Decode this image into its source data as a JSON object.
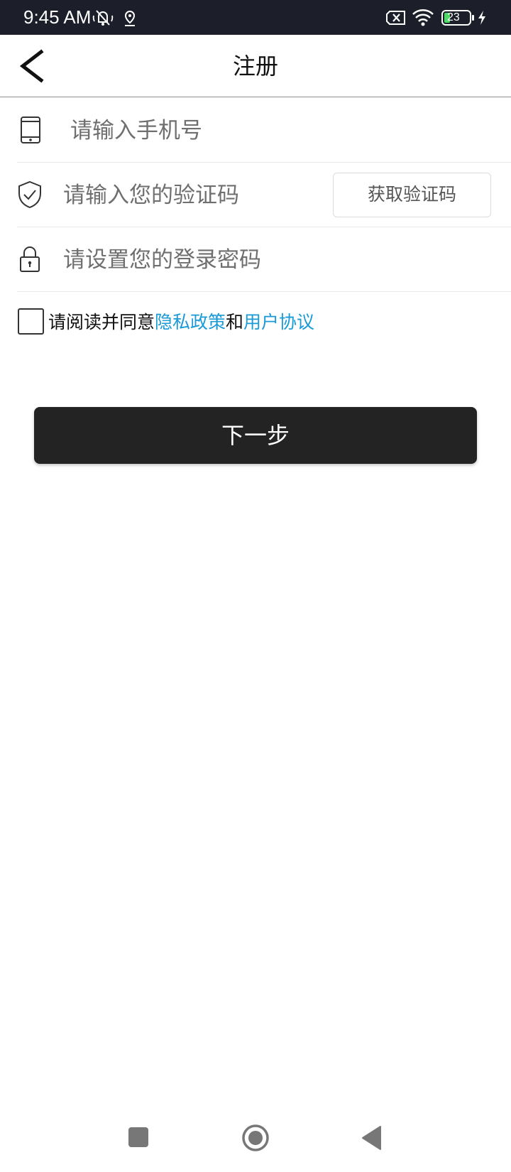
{
  "status_bar": {
    "time": "9:45 AM",
    "battery": "23",
    "icons": [
      "mute-icon",
      "location-icon",
      "no-sim-icon",
      "wifi-icon",
      "battery-icon",
      "charging-icon"
    ]
  },
  "header": {
    "title": "注册",
    "back_icon": "chevron-left-icon"
  },
  "form": {
    "phone": {
      "placeholder": "请输入手机号",
      "value": "",
      "icon": "phone-icon"
    },
    "code": {
      "placeholder": "请输入您的验证码",
      "value": "",
      "icon": "shield-check-icon",
      "button_label": "获取验证码"
    },
    "password": {
      "placeholder": "请设置您的登录密码",
      "value": "",
      "icon": "lock-icon"
    }
  },
  "agreement": {
    "prefix": "请阅读并同意",
    "privacy_link": "隐私政策",
    "conjunction": "和",
    "terms_link": "用户协议",
    "checked": false
  },
  "next_button": {
    "label": "下一步"
  },
  "nav_bar": {
    "items": [
      "recents-square-icon",
      "home-circle-icon",
      "back-triangle-icon"
    ]
  },
  "colors": {
    "status_bar_bg": "#1c1f2a",
    "link": "#1a9ad6",
    "primary_button": "#232323",
    "battery_fill": "#4cd964"
  }
}
